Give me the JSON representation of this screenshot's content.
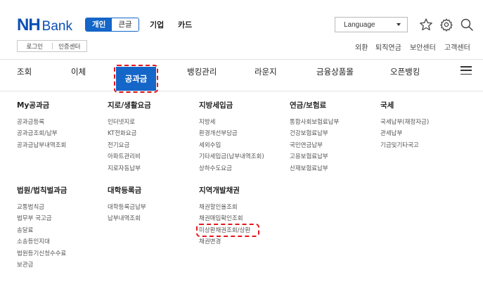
{
  "header": {
    "logo_nh": "NH",
    "logo_bank": "Bank",
    "segment": [
      "개인",
      "큰글"
    ],
    "top_nav": [
      "기업",
      "카드"
    ],
    "language_select": "Language",
    "login_links": [
      "로그인",
      "인증센터"
    ],
    "util_links": [
      "외환",
      "퇴직연금",
      "보안센터",
      "고객센터"
    ],
    "icons": [
      "star-icon",
      "gear-icon",
      "search-icon"
    ]
  },
  "gnb": {
    "items": [
      "조회",
      "이체",
      "공과금",
      "뱅킹관리",
      "라운지",
      "금융상품몰",
      "오픈뱅킹"
    ],
    "active": "공과금",
    "accent_color": "#1466c8",
    "highlight_color": "#e4141d"
  },
  "megamenu": {
    "row1": [
      {
        "title": "My공과금",
        "items": [
          "공과금등록",
          "공과금조회/납부",
          "공과금납부내역조회"
        ]
      },
      {
        "title": "지로/생활요금",
        "items": [
          "인터넷지로",
          "KT전화요금",
          "전기요금",
          "아파트관리비",
          "지로자동납부"
        ]
      },
      {
        "title": "지방세입금",
        "items": [
          "지방세",
          "환경개선부담금",
          "세외수입",
          "기타세입금(납부내역조회)",
          "상하수도요금"
        ]
      },
      {
        "title": "연금/보험료",
        "items": [
          "통합사회보험료납부",
          "건강보험료납부",
          "국민연금납부",
          "고용보험료납부",
          "산재보험료납부"
        ]
      },
      {
        "title": "국세",
        "items": [
          "국세납부(재정자금)",
          "관세납부",
          "기금및기타국고"
        ]
      }
    ],
    "row2": [
      {
        "title": "법원/법칙벌과금",
        "items": [
          "교통범칙금",
          "법무부 국고금",
          "송달료",
          "소송등인지대",
          "법원등기신청수수료",
          "보관금"
        ]
      },
      {
        "title": "대학등록금",
        "items": [
          "대학등록금납부",
          "납부내역조회"
        ]
      },
      {
        "title": "지역개발채권",
        "items": [
          "채권할인율조회",
          "채권매입확인조회",
          "미상환채권조회/상환",
          "채권변경"
        ]
      }
    ]
  }
}
